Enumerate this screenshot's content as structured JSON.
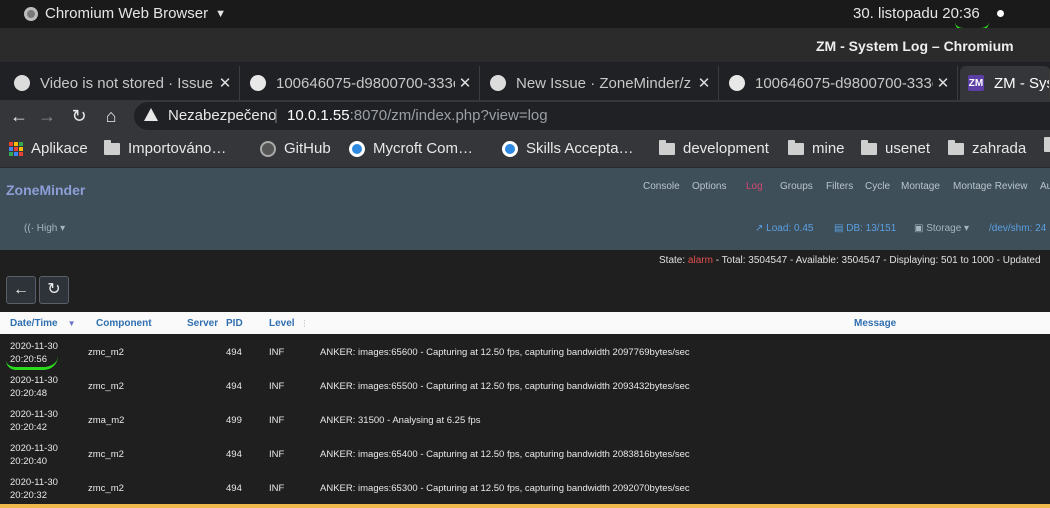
{
  "topbar": {
    "app_name": "Chromium Web Browser",
    "clock": "30. listopadu 20:36"
  },
  "window": {
    "title": "ZM - System Log – Chromium"
  },
  "tabs": [
    {
      "label": "Video is not stored · Issue",
      "icon": "github-icon"
    },
    {
      "label": "100646075-d9800700-333c",
      "icon": "globe-icon"
    },
    {
      "label": "New Issue · ZoneMinder/z",
      "icon": "github-icon"
    },
    {
      "label": "100646075-d9800700-333c",
      "icon": "globe-icon"
    },
    {
      "label": "ZM - Syst",
      "icon": "zm-icon",
      "icon_text": "ZM"
    }
  ],
  "address": {
    "security": "Nezabezpečeno",
    "host": "10.0.1.55",
    "rest": ":8070/zm/index.php?view=log"
  },
  "bookmarks": [
    {
      "label": "Aplikace",
      "icon": "apps-grid-icon"
    },
    {
      "label": "Importováno…",
      "icon": "folder-icon"
    },
    {
      "label": "GitHub",
      "icon": "github-icon"
    },
    {
      "label": "Mycroft Com…",
      "icon": "mycroft-icon"
    },
    {
      "label": "Skills Accepta…",
      "icon": "mycroft-icon"
    },
    {
      "label": "development",
      "icon": "folder-icon"
    },
    {
      "label": "mine",
      "icon": "folder-icon"
    },
    {
      "label": "usenet",
      "icon": "folder-icon"
    },
    {
      "label": "zahrada",
      "icon": "folder-icon"
    }
  ],
  "zm": {
    "brand": "ZoneMinder",
    "menu": [
      "Console",
      "Options",
      "Log",
      "Groups",
      "Filters",
      "Cycle",
      "Montage",
      "Montage Review",
      "Au"
    ],
    "active_menu": "Log",
    "bandwidth": "High",
    "load": "Load: 0.45",
    "db": "DB: 13/151",
    "storage": "Storage",
    "shm": "/dev/shm: 24"
  },
  "state_line": {
    "state_label": "State: ",
    "state_value": "alarm",
    "rest": " -  Total: 3504547 -  Available: 3504547 -  Displaying: 501 to 1000 -  Updated"
  },
  "buttons": {
    "back_icon": "←",
    "refresh_icon": "↻"
  },
  "table": {
    "headers": [
      "Date/Time",
      "Component",
      "Server",
      "PID",
      "Level",
      "Message"
    ],
    "rows": [
      {
        "date": "2020-11-30",
        "time": "20:20:56",
        "component": "zmc_m2",
        "server": "",
        "pid": "494",
        "level": "INF",
        "message": "ANKER: images:65600 - Capturing at 12.50 fps, capturing bandwidth 2097769bytes/sec"
      },
      {
        "date": "2020-11-30",
        "time": "20:20:48",
        "component": "zmc_m2",
        "server": "",
        "pid": "494",
        "level": "INF",
        "message": "ANKER: images:65500 - Capturing at 12.50 fps, capturing bandwidth 2093432bytes/sec"
      },
      {
        "date": "2020-11-30",
        "time": "20:20:42",
        "component": "zma_m2",
        "server": "",
        "pid": "499",
        "level": "INF",
        "message": "ANKER: 31500 - Analysing at 6.25 fps"
      },
      {
        "date": "2020-11-30",
        "time": "20:20:40",
        "component": "zmc_m2",
        "server": "",
        "pid": "494",
        "level": "INF",
        "message": "ANKER: images:65400 - Capturing at 12.50 fps, capturing bandwidth 2083816bytes/sec"
      },
      {
        "date": "2020-11-30",
        "time": "20:20:32",
        "component": "zmc_m2",
        "server": "",
        "pid": "494",
        "level": "INF",
        "message": "ANKER: images:65300 - Capturing at 12.50 fps, capturing bandwidth 2092070bytes/sec"
      }
    ]
  }
}
